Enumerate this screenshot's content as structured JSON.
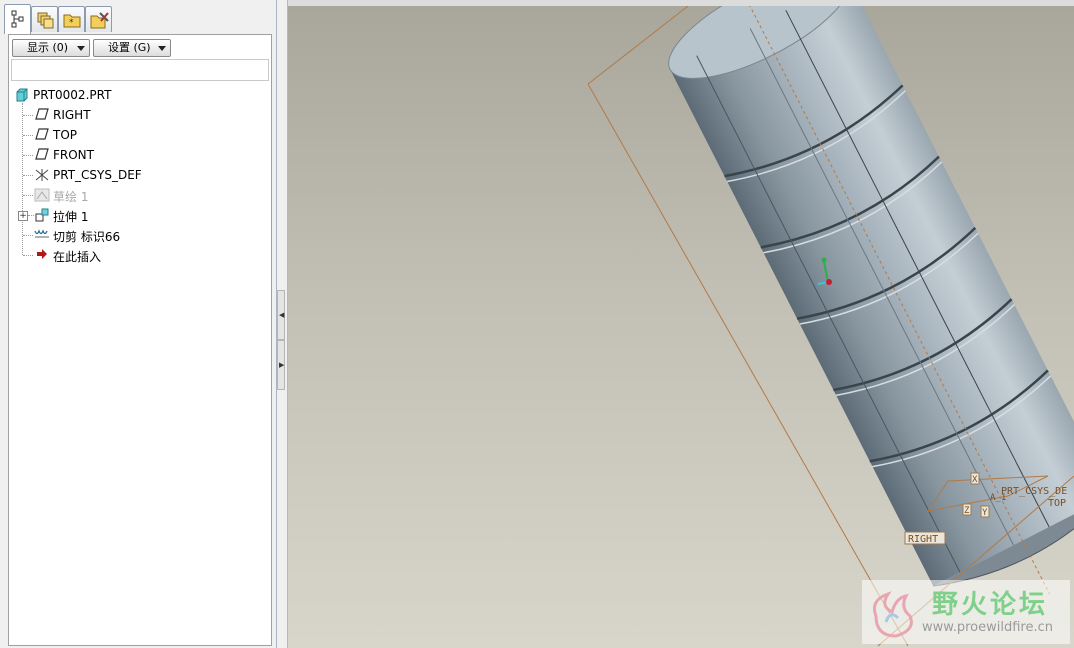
{
  "tabs": [
    {
      "icon": "model-tree-icon",
      "active": true
    },
    {
      "icon": "layers-icon",
      "active": false
    },
    {
      "icon": "folder-browser-icon",
      "active": false
    },
    {
      "icon": "favorites-tools-icon",
      "active": false
    }
  ],
  "toolbar": {
    "show_label": "显示 (0)",
    "settings_label": "设置 (G)"
  },
  "tree": {
    "root": "PRT0002.PRT",
    "items": [
      {
        "label": "RIGHT",
        "icon": "datum-plane-icon"
      },
      {
        "label": "TOP",
        "icon": "datum-plane-icon"
      },
      {
        "label": "FRONT",
        "icon": "datum-plane-icon"
      },
      {
        "label": "PRT_CSYS_DEF",
        "icon": "coordinate-system-icon"
      },
      {
        "label": "草绘 1",
        "icon": "sketch-icon",
        "suppressed": true
      },
      {
        "label": "拉伸 1",
        "icon": "extrude-icon",
        "expandable": true
      },
      {
        "label": "切剪 标识66",
        "icon": "cut-icon"
      },
      {
        "label": "在此插入",
        "icon": "insert-here-arrow-icon"
      }
    ]
  },
  "viewport": {
    "datum_labels": {
      "right": "RIGHT",
      "csys": "PRT_CSYS_DE",
      "top": "TOP",
      "axis": "A_1",
      "x": "X",
      "y": "Y",
      "z": "Z"
    }
  },
  "watermark": {
    "title": "野火论坛",
    "url": "www.proewildfire.cn"
  }
}
